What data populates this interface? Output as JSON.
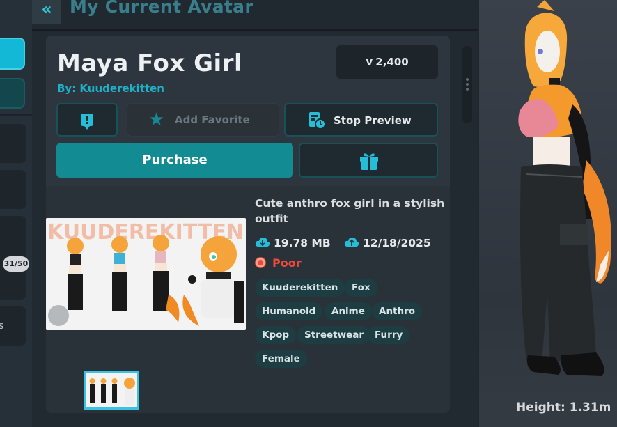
{
  "left_strip": {
    "counter": "31/50",
    "edge_text": "s"
  },
  "header": {
    "back_glyph": "«",
    "title": "My Current Avatar"
  },
  "avatar": {
    "name": "Maya Fox Girl",
    "author": "By: Kuuderekitten",
    "price": "2,400",
    "currency_glyph": "V",
    "description": "Cute anthro fox girl in a stylish outfit",
    "file_size": "19.78 MB",
    "date": "12/18/2025",
    "performance": "Poor",
    "tags": [
      "Kuuderekitten",
      "Fox",
      "Humanoid",
      "Anime",
      "Anthro",
      "Kpop",
      "Streetwear",
      "Furry",
      "Female"
    ],
    "thumbnail_text": "KUUDEREKITTEN"
  },
  "actions": {
    "report_icon": "report-icon",
    "favorite_label": "Add Favorite",
    "stop_preview_label": "Stop Preview",
    "purchase_label": "Purchase",
    "gift_icon": "gift-icon"
  },
  "preview": {
    "height_label": "Height: 1.31m"
  },
  "colors": {
    "accent": "#138b92",
    "link": "#1fb0c8",
    "poor": "#ea4a3c",
    "active_tab": "#12b8d6"
  }
}
